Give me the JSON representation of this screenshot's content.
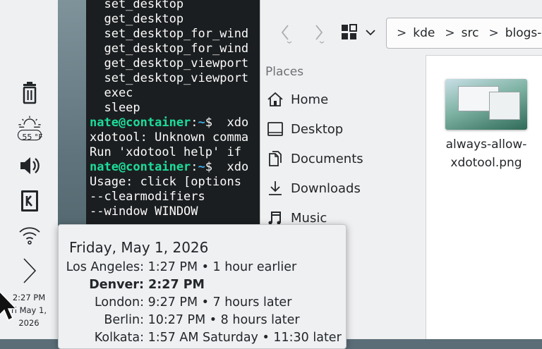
{
  "panel": {
    "items": [
      {
        "name": "trash",
        "icon": "trash-icon"
      },
      {
        "name": "weather",
        "icon": "weather-partly-sunny-icon",
        "badge": "55 °F"
      },
      {
        "name": "volume",
        "icon": "speaker-icon"
      },
      {
        "name": "kde-connect",
        "icon": "kde-k-icon"
      },
      {
        "name": "network",
        "icon": "wifi-icon"
      },
      {
        "name": "expand",
        "icon": "chevron-right-icon"
      }
    ],
    "clock": {
      "time": "2:27 PM",
      "date_line1": "ri May 1,",
      "date_line2": "2026"
    }
  },
  "terminal": {
    "prompt_user": "nate@container",
    "prompt_sep": ":",
    "prompt_path": "~",
    "prompt_dollar": "$",
    "lines": [
      {
        "text": "  set_desktop"
      },
      {
        "text": "  get_desktop"
      },
      {
        "text": "  set_desktop_for_wind"
      },
      {
        "text": "  get_desktop_for_wind"
      },
      {
        "text": "  get_desktop_viewport"
      },
      {
        "text": "  set_desktop_viewport"
      },
      {
        "text": "  exec"
      },
      {
        "text": "  sleep"
      },
      {
        "prompt": true,
        "text": "  xdo"
      },
      {
        "text": "xdotool: Unknown comma"
      },
      {
        "text": "Run 'xdotool help' if"
      },
      {
        "prompt": true,
        "text": "  xdo"
      },
      {
        "text": "Usage: click [options"
      },
      {
        "text": "--clearmodifiers"
      },
      {
        "text": "--window WINDOW"
      }
    ]
  },
  "dolphin": {
    "breadcrumb": [
      "kde",
      "src",
      "blogs-"
    ],
    "places_header": "Places",
    "places": [
      {
        "label": "Home",
        "icon": "home-icon"
      },
      {
        "label": "Desktop",
        "icon": "desktop-icon"
      },
      {
        "label": "Documents",
        "icon": "documents-icon"
      },
      {
        "label": "Downloads",
        "icon": "downloads-icon"
      },
      {
        "label": "Music",
        "icon": "music-icon"
      }
    ],
    "file": {
      "line1": "always-allow-",
      "line2": "xdotool.png"
    }
  },
  "popup": {
    "date": "Friday, May 1, 2026",
    "zones": [
      {
        "city": "Los Angeles:",
        "info": " 1:27 PM • 1 hour earlier",
        "bold": false
      },
      {
        "city": "Denver:",
        "info": " 2:27 PM",
        "bold": true
      },
      {
        "city": "London:",
        "info": " 9:27 PM • 7 hours later",
        "bold": false
      },
      {
        "city": "Berlin:",
        "info": " 10:27 PM • 8 hours later",
        "bold": false
      },
      {
        "city": "Kolkata:",
        "info": " 1:57 AM Saturday • 11:30 later",
        "bold": false
      }
    ]
  }
}
